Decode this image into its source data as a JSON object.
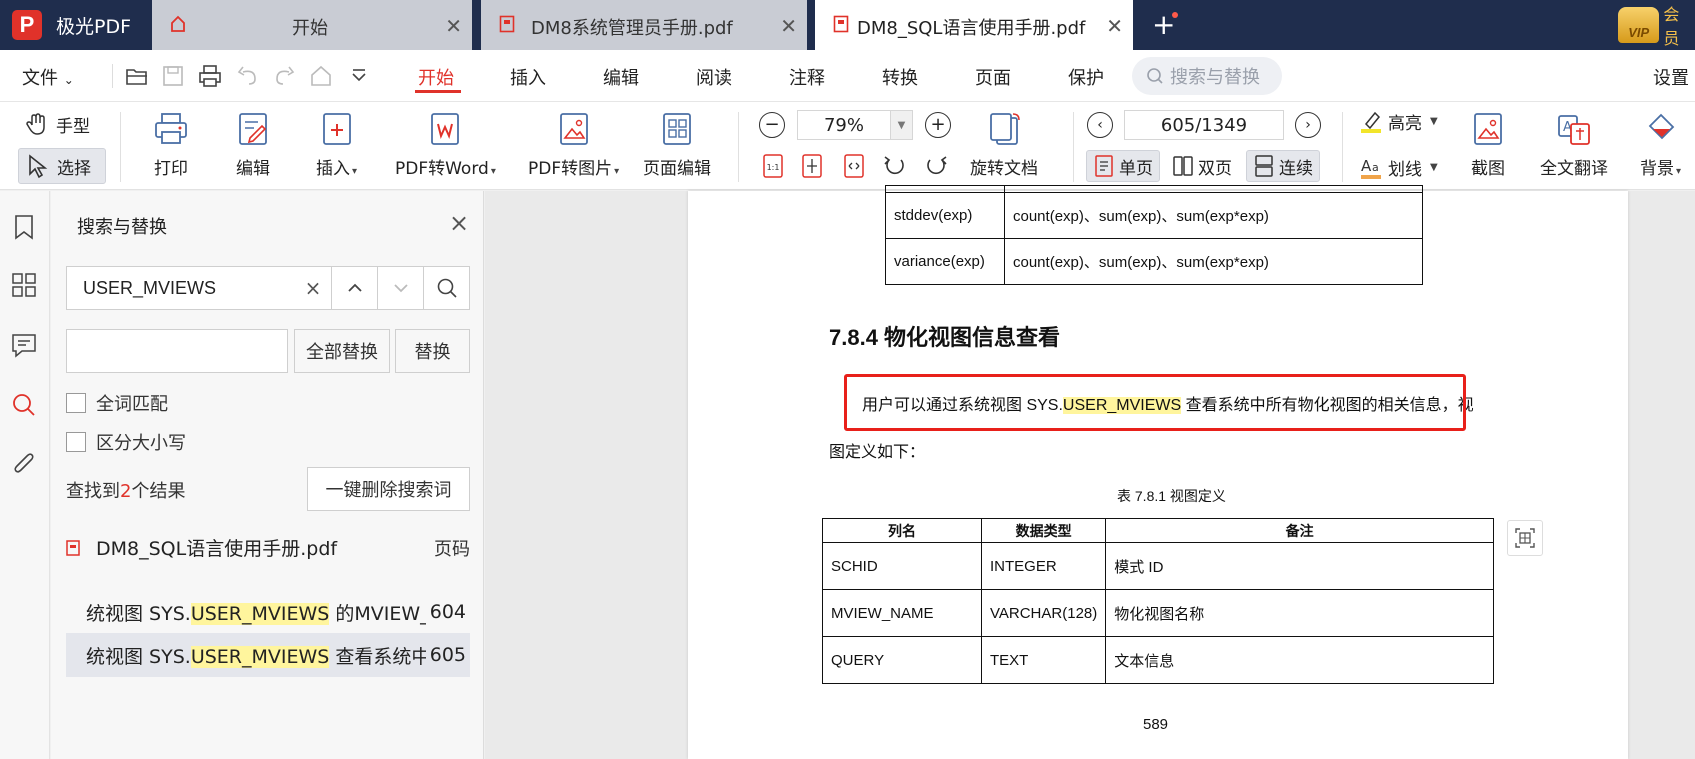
{
  "app": {
    "name": "极光PDF",
    "logo_letter": "P",
    "vip_label": "会员",
    "vip_badge": "VIP"
  },
  "tabs": [
    {
      "label": "开始",
      "active": false
    },
    {
      "label": "DM8系统管理员手册.pdf",
      "active": false
    },
    {
      "label": "DM8_SQL语言使用手册.pdf",
      "active": true
    }
  ],
  "menu": {
    "file": "文件",
    "items": [
      "开始",
      "插入",
      "编辑",
      "阅读",
      "注释",
      "转换",
      "页面",
      "保护"
    ],
    "active": "开始",
    "search_placeholder": "搜索与替换",
    "settings": "设置"
  },
  "toolbar": {
    "hand": "手型",
    "select": "选择",
    "print": "打印",
    "edit": "编辑",
    "insert": "插入",
    "pdf_to_word": "PDF转Word",
    "pdf_to_image": "PDF转图片",
    "page_edit": "页面编辑",
    "zoom": "79%",
    "rotate_doc": "旋转文档",
    "page_indicator": "605/1349",
    "single_page": "单页",
    "double_page": "双页",
    "continuous": "连续",
    "highlight": "高亮",
    "strikethrough": "划线",
    "screenshot": "截图",
    "translate": "全文翻译",
    "background": "背景",
    "fit_label": "1:1"
  },
  "panel": {
    "title": "搜索与替换",
    "search_value": "USER_MVIEWS",
    "replace_value": "",
    "replace_all": "全部替换",
    "replace": "替换",
    "whole_word": "全词匹配",
    "match_case": "区分大小写",
    "result_prefix": "查找到",
    "result_count": "2",
    "result_suffix": "个结果",
    "clear_button": "一键删除搜索词",
    "file_name": "DM8_SQL语言使用手册.pdf",
    "page_header": "页码",
    "results": [
      {
        "pre": "统视图 SYS.",
        "match": "USER_MVIEWS",
        "post": " 的MVIEW_T",
        "page": "604",
        "selected": false
      },
      {
        "pre": "统视图 SYS.",
        "match": "USER_MVIEWS",
        "post": " 查看系统中所",
        "page": "605",
        "selected": true
      }
    ]
  },
  "document": {
    "top_table": [
      {
        "func": "stddev(exp)",
        "formula": "count(exp)、sum(exp)、sum(exp*exp)"
      },
      {
        "func": "variance(exp)",
        "formula": "count(exp)、sum(exp)、sum(exp*exp)"
      }
    ],
    "heading": "7.8.4  物化视图信息查看",
    "para_pre": "用户可以通过系统视图 SYS.",
    "para_match": "USER_MVIEWS",
    "para_post": " 查看系统中所有物化视图的相关信息，视",
    "para_line2": "图定义如下：",
    "caption": "表 7.8.1  视图定义",
    "table_headers": [
      "列名",
      "数据类型",
      "备注"
    ],
    "table_rows": [
      [
        "SCHID",
        "INTEGER",
        "模式 ID"
      ],
      [
        "MVIEW_NAME",
        "VARCHAR(128)",
        "物化视图名称"
      ],
      [
        "QUERY",
        "TEXT",
        "文本信息"
      ]
    ],
    "page_number": "589"
  },
  "colors": {
    "accent": "#e0322a",
    "titlebar": "#1f2d4d",
    "highlight": "#fff59d",
    "red_box": "#e8201a"
  }
}
